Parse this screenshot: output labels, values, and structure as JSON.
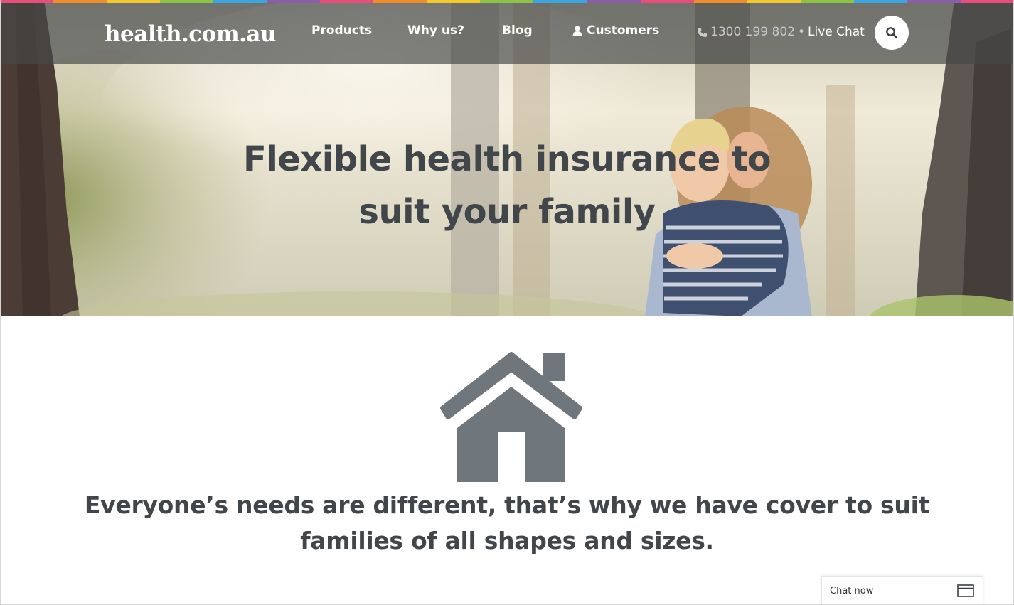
{
  "rainbow_colors": [
    "#e94d7a",
    "#f18c2b",
    "#f4c92c",
    "#8bc543",
    "#3aa5e0",
    "#8b5fa8",
    "#e94d7a",
    "#f18c2b",
    "#f4c92c",
    "#8bc543",
    "#3aa5e0",
    "#8b5fa8",
    "#e94d7a",
    "#f18c2b",
    "#f4c92c",
    "#8bc543",
    "#3aa5e0",
    "#8b5fa8",
    "#e94d7a"
  ],
  "header": {
    "logo": "health.com.au",
    "nav": {
      "products": "Products",
      "why_us": "Why us?",
      "blog": "Blog",
      "customers": "Customers"
    },
    "phone": "1300 199 802",
    "separator": "•",
    "live_chat": "Live Chat",
    "search_icon": "search-icon"
  },
  "hero": {
    "title_line1": "Flexible health insurance to",
    "title_line2": "suit your family",
    "image": "mother-hugging-child-in-forest"
  },
  "content": {
    "icon": "house-icon",
    "tagline_line1": "Everyone’s needs are different, that’s why we have cover to suit",
    "tagline_line2": "families of all shapes and sizes."
  },
  "chat_widget": {
    "label": "Chat now",
    "icon": "window-icon"
  },
  "colors": {
    "text_dark": "#41464b",
    "icon_grey": "#6f767c",
    "nav_overlay": "rgba(70,72,72,0.68)"
  }
}
